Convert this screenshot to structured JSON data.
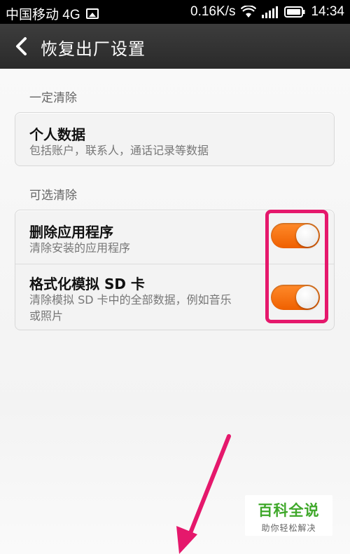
{
  "status_bar": {
    "carrier": "中国移动 4G",
    "speed": "0.16K/s",
    "time": "14:34"
  },
  "header": {
    "title": "恢复出厂设置"
  },
  "sections": {
    "required_label": "一定清除",
    "optional_label": "可选清除"
  },
  "required_item": {
    "title": "个人数据",
    "subtitle": "包括账户，联系人，通话记录等数据"
  },
  "optional_items": [
    {
      "title": "删除应用程序",
      "subtitle": "清除安装的应用程序",
      "enabled": true
    },
    {
      "title": "格式化模拟 SD 卡",
      "subtitle_line1": "清除模拟 SD 卡中的全部数据，例如音乐",
      "subtitle_line2": "或照片",
      "enabled": true
    }
  ],
  "watermark": {
    "title": "百科全说",
    "subtitle": "助你轻松解决"
  },
  "colors": {
    "toggle_on": "#f06a10",
    "highlight": "#e5186c",
    "watermark_green": "#3fa82a"
  }
}
